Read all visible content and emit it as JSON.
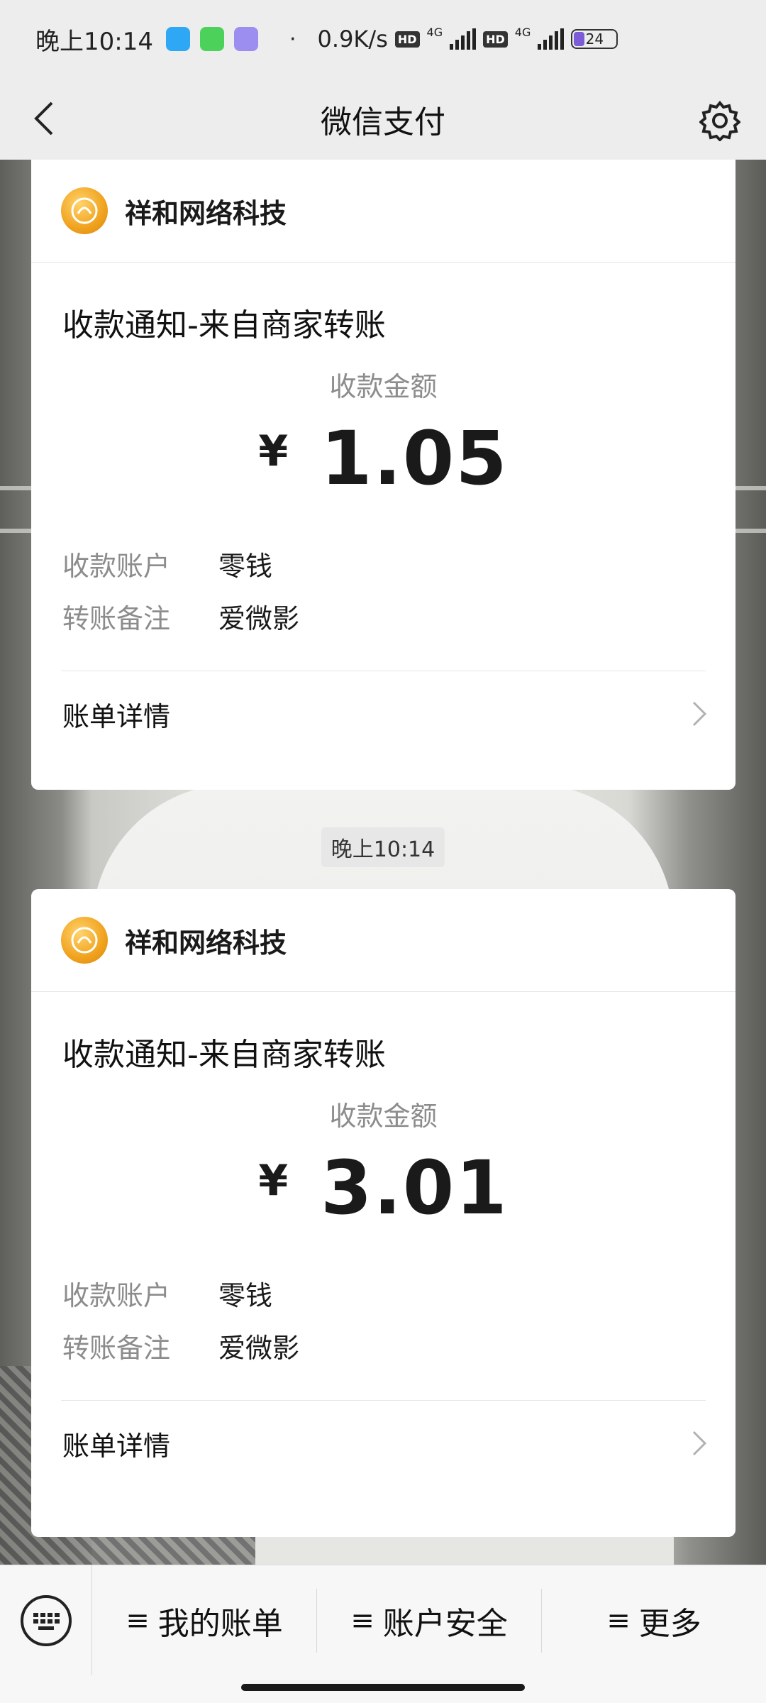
{
  "status_bar": {
    "time": "晚上10:14",
    "net_speed": "0.9K/s",
    "hd_badge": "HD",
    "net_type": "4G",
    "battery": "24",
    "separator": "·"
  },
  "nav": {
    "title": "微信支付"
  },
  "messages": [
    {
      "merchant": "祥和网络科技",
      "notice_title": "收款通知-来自商家转账",
      "amount_label": "收款金额",
      "currency": "¥",
      "amount": "1.05",
      "rows": [
        {
          "key": "收款账户",
          "value": "零钱"
        },
        {
          "key": "转账备注",
          "value": "爱微影"
        }
      ],
      "detail_label": "账单详情"
    },
    {
      "merchant": "祥和网络科技",
      "notice_title": "收款通知-来自商家转账",
      "amount_label": "收款金额",
      "currency": "¥",
      "amount": "3.01",
      "rows": [
        {
          "key": "收款账户",
          "value": "零钱"
        },
        {
          "key": "转账备注",
          "value": "爱微影"
        }
      ],
      "detail_label": "账单详情"
    }
  ],
  "timestamp": "晚上10:14",
  "bottom_menu": {
    "items": [
      {
        "label": "我的账单"
      },
      {
        "label": "账户安全"
      },
      {
        "label": "更多"
      }
    ]
  },
  "colors": {
    "accent": "#f0a21e",
    "nav_bg": "#ededed"
  }
}
